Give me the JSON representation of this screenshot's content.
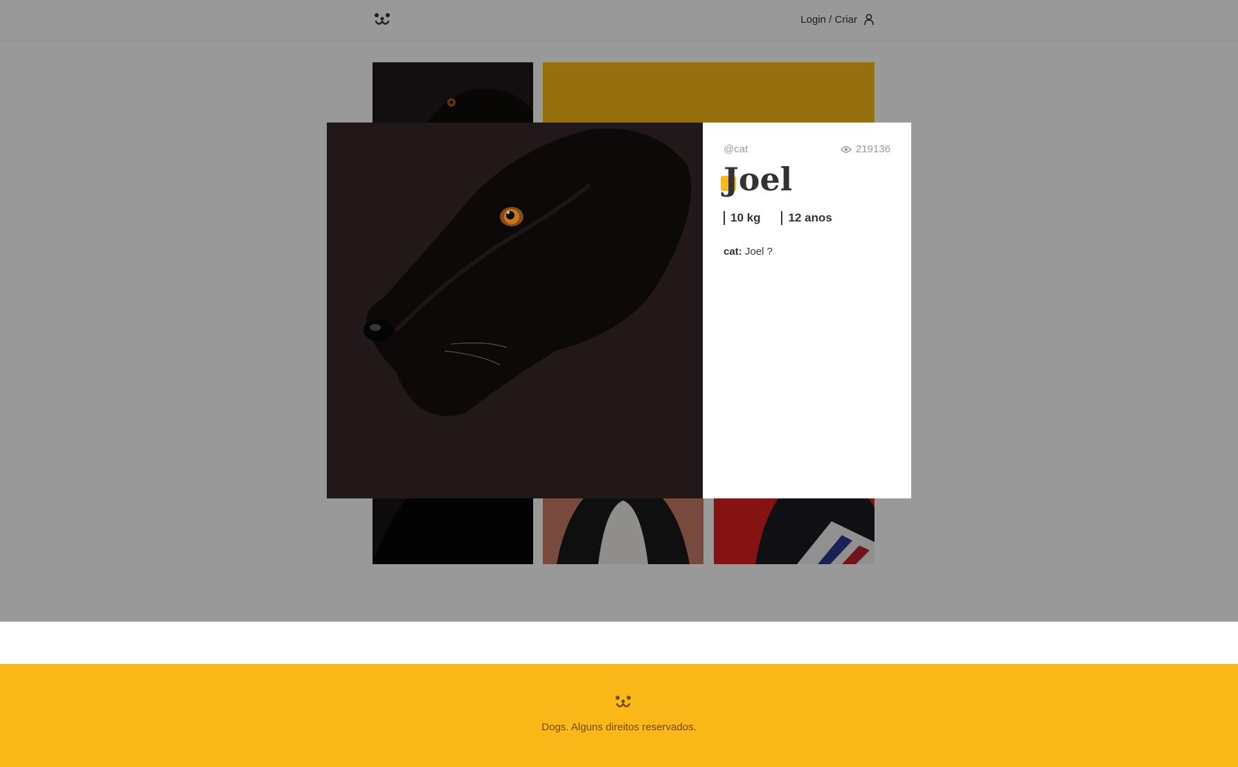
{
  "header": {
    "logo_icon": "dog-face-icon",
    "login_label": "Login / Criar",
    "user_icon": "user-icon"
  },
  "feed": {
    "tiles": [
      {
        "subject": "black dog close-up"
      },
      {
        "subject": "yellow placeholder"
      },
      {
        "subject": "black dog dark"
      },
      {
        "subject": "black and white dog"
      },
      {
        "subject": "dog in striped shirt on red"
      }
    ]
  },
  "modal": {
    "author": "@cat",
    "views": "219136",
    "views_icon": "eye-icon",
    "title": "Joel",
    "weight": "10 kg",
    "age": "12 anos",
    "comments": [
      {
        "author": "cat:",
        "text": " Joel ?"
      }
    ]
  },
  "footer": {
    "logo_icon": "dog-face-icon",
    "text": "Dogs. Alguns direitos reservados."
  },
  "colors": {
    "brand_yellow": "#fbb919",
    "footer_text": "#764701",
    "overlay": "rgba(0,0,0,0.4)"
  }
}
